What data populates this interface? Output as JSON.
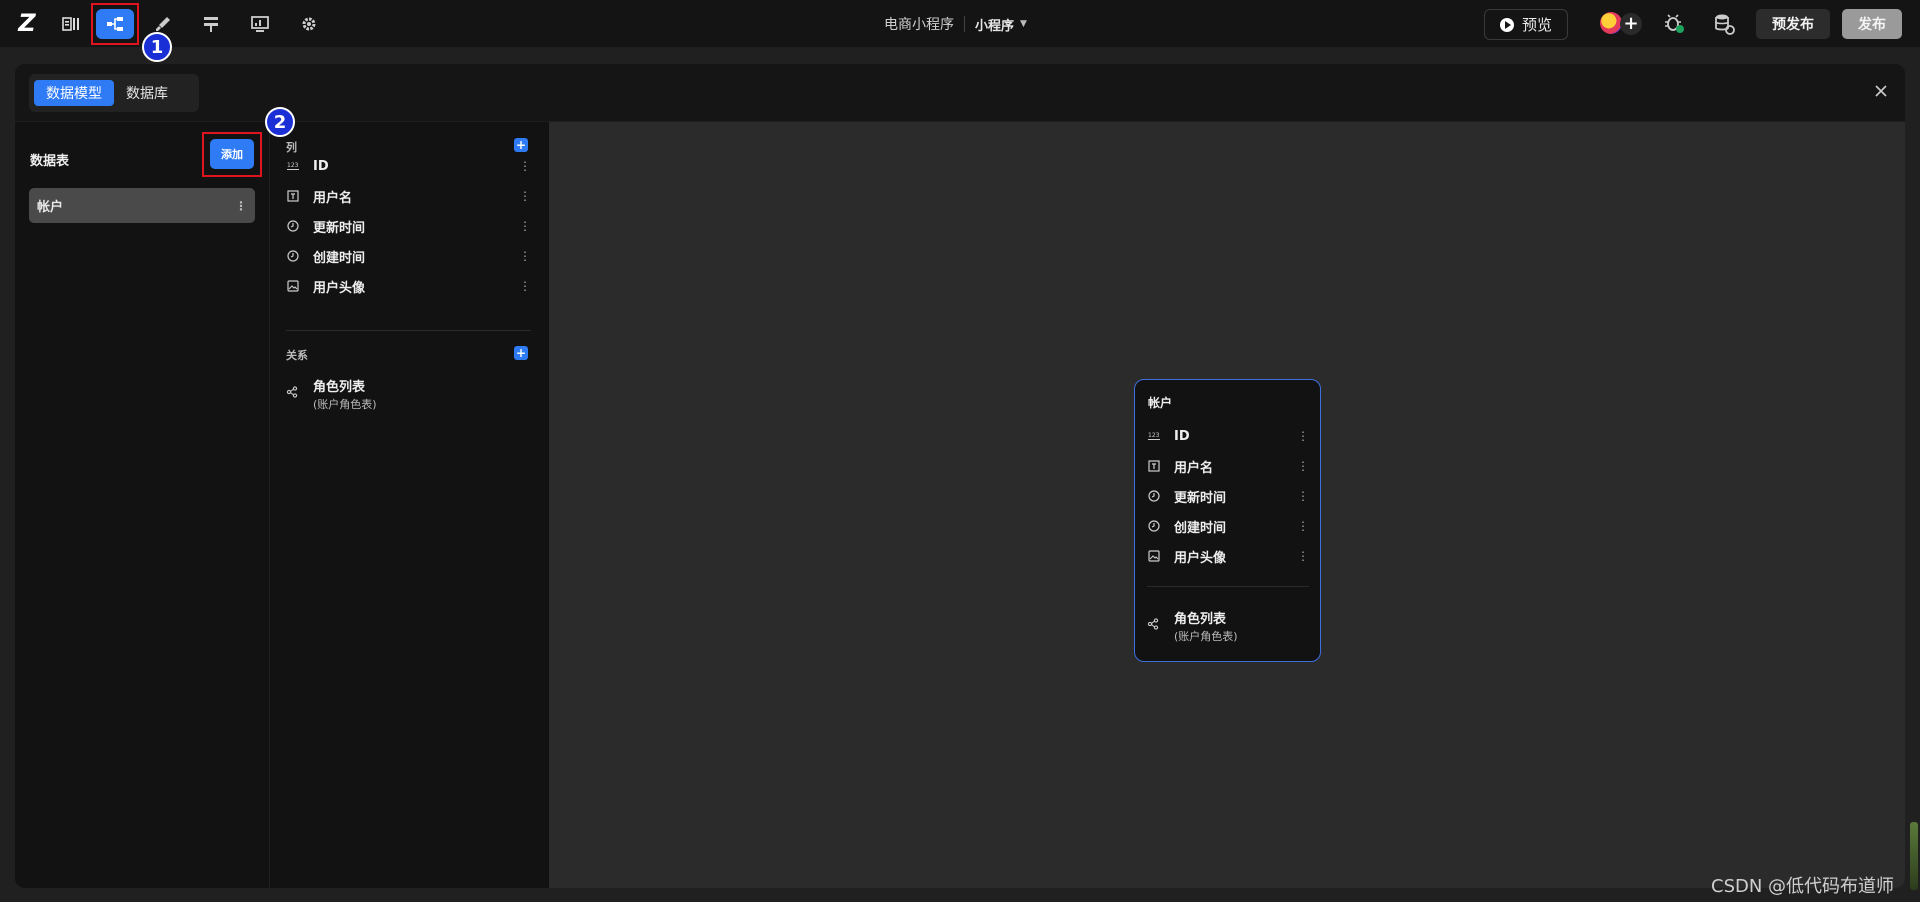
{
  "topbar": {
    "logo": "Z",
    "app_name": "电商小程序",
    "platform": "小程序",
    "preview_label": "预览",
    "collab_plus": "+",
    "prepublish_label": "预发布",
    "publish_label": "发布",
    "tools": [
      "pages-icon",
      "data-model-icon",
      "paint-icon",
      "workflow-icon",
      "dashboard-icon",
      "settings-icon"
    ],
    "active_tool": "data-model-icon"
  },
  "annotations": {
    "marker_1": "1",
    "marker_2": "2",
    "marker_color": "#1a2fd6",
    "box_color": "#e0141e"
  },
  "panel": {
    "tabs": [
      {
        "label": "数据模型",
        "active": true
      },
      {
        "label": "数据库",
        "active": false
      }
    ],
    "tables_title": "数据表",
    "add_label": "添加",
    "tables": [
      {
        "name": "帐户"
      }
    ],
    "columns_label": "列",
    "relations_label": "关系",
    "columns": [
      {
        "name": "ID",
        "icon": "number-icon"
      },
      {
        "name": "用户名",
        "icon": "text-icon"
      },
      {
        "name": "更新时间",
        "icon": "clock-icon"
      },
      {
        "name": "创建时间",
        "icon": "clock-icon"
      },
      {
        "name": "用户头像",
        "icon": "image-icon"
      }
    ],
    "relations": [
      {
        "name": "角色列表",
        "sub": "(账户角色表)",
        "icon": "relation-icon"
      }
    ]
  },
  "card": {
    "title": "帐户",
    "columns": [
      {
        "name": "ID"
      },
      {
        "name": "用户名"
      },
      {
        "name": "更新时间"
      },
      {
        "name": "创建时间"
      },
      {
        "name": "用户头像"
      }
    ],
    "relation": {
      "name": "角色列表",
      "sub": "(账户角色表)"
    }
  },
  "watermark": "CSDN @低代码布道师",
  "colors": {
    "accent": "#2f7bf5",
    "card_border": "#3d6fe0"
  }
}
